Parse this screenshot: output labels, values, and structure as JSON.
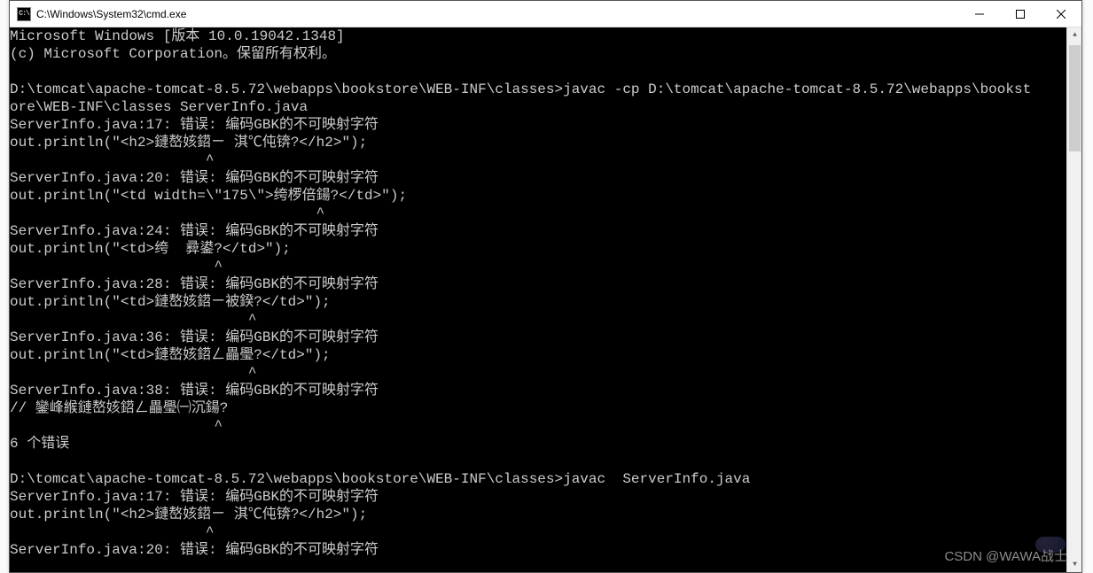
{
  "window": {
    "title": "C:\\Windows\\System32\\cmd.exe",
    "icon_label": "C:\\"
  },
  "console": {
    "lines": [
      "Microsoft Windows [版本 10.0.19042.1348]",
      "(c) Microsoft Corporation。保留所有权利。",
      "",
      "D:\\tomcat\\apache-tomcat-8.5.72\\webapps\\bookstore\\WEB-INF\\classes>javac -cp D:\\tomcat\\apache-tomcat-8.5.72\\webapps\\bookst",
      "ore\\WEB-INF\\classes ServerInfo.java",
      "ServerInfo.java:17: 错误: 编码GBK的不可映射字符",
      "out.println(\"<h2>鏈嶅姟鍣ㄧ 淇℃伅锛?</h2>\");",
      "                       ^",
      "ServerInfo.java:20: 错误: 编码GBK的不可映射字符",
      "out.println(\"<td width=\\\"175\\\">绔椤倍鍚?</td>\");",
      "                                    ^",
      "ServerInfo.java:24: 错误: 编码GBK的不可映射字符",
      "out.println(\"<td>绔  彛鍙?</td>\");",
      "                        ^",
      "ServerInfo.java:28: 错误: 编码GBK的不可映射字符",
      "out.println(\"<td>鏈嶅姟鍣ㄧ被鍨?</td>\");",
      "                            ^",
      "ServerInfo.java:36: 错误: 编码GBK的不可映射字符",
      "out.println(\"<td>鏈嶅姟鍣ㄥ畾璺?</td>\");",
      "                            ^",
      "ServerInfo.java:38: 错误: 编码GBK的不可映射字符",
      "// 鑾峰緱鏈嶅姟鍣ㄥ畾璺㈠沉鍚?",
      "                        ^",
      "6 个错误",
      "",
      "D:\\tomcat\\apache-tomcat-8.5.72\\webapps\\bookstore\\WEB-INF\\classes>javac  ServerInfo.java",
      "ServerInfo.java:17: 错误: 编码GBK的不可映射字符",
      "out.println(\"<h2>鏈嶅姟鍣ㄧ 淇℃伅锛?</h2>\");",
      "                       ^",
      "ServerInfo.java:20: 错误: 编码GBK的不可映射字符"
    ]
  },
  "watermark": "CSDN @WAWA战士"
}
